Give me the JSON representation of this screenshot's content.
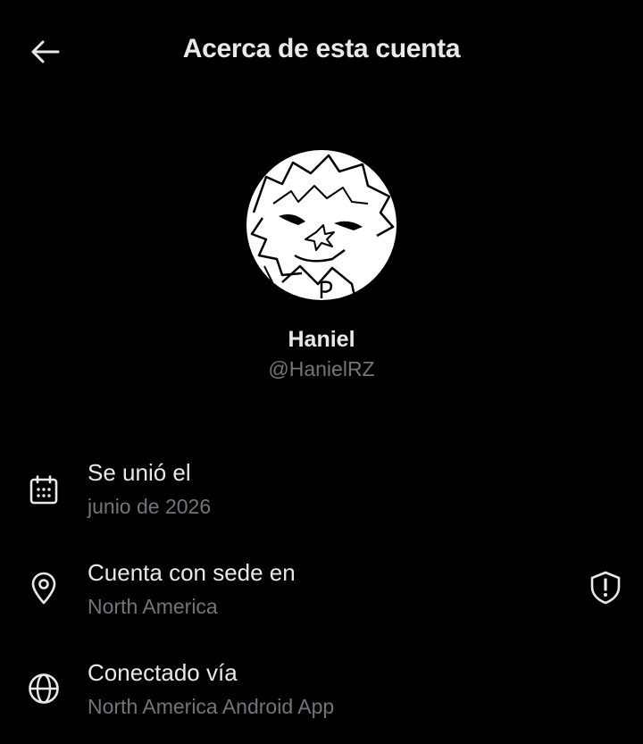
{
  "header": {
    "title": "Acerca de esta cuenta",
    "back_icon": "arrow-left-icon"
  },
  "profile": {
    "display_name": "Haniel",
    "handle": "@HanielRZ"
  },
  "details": [
    {
      "icon": "calendar-icon",
      "label": "Se unió el",
      "value": "junio de 2026"
    },
    {
      "icon": "location-pin-icon",
      "label": "Cuenta con sede en",
      "value": "North America",
      "badge_icon": "shield-alert-icon"
    },
    {
      "icon": "globe-icon",
      "label": "Conectado vía",
      "value": "North America Android App"
    }
  ],
  "colors": {
    "background": "#000000",
    "primary_text": "#e7e9ea",
    "secondary_text": "#71767b"
  }
}
